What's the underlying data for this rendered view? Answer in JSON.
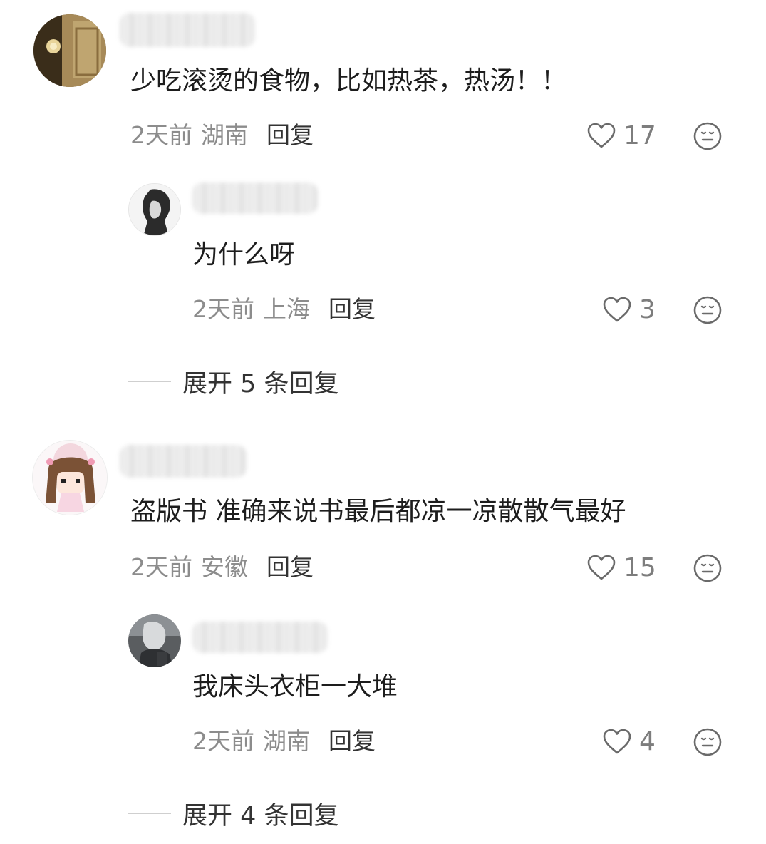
{
  "comments": [
    {
      "text": "少吃滚烫的食物，比如热茶，热汤！！",
      "time": "2天前",
      "location": "湖南",
      "reply_label": "回复",
      "likes": "17",
      "replies": [
        {
          "text": "为什么呀",
          "time": "2天前",
          "location": "上海",
          "reply_label": "回复",
          "likes": "3"
        }
      ],
      "expand_label": "展开 5 条回复"
    },
    {
      "text": "盗版书 准确来说书最后都凉一凉散散气最好",
      "time": "2天前",
      "location": "安徽",
      "reply_label": "回复",
      "likes": "15",
      "replies": [
        {
          "text": "我床头衣柜一大堆",
          "time": "2天前",
          "location": "湖南",
          "reply_label": "回复",
          "likes": "4"
        }
      ],
      "expand_label": "展开 4 条回复"
    }
  ],
  "icons": {
    "like": "heart-outline-icon",
    "reaction": "neutral-face-icon"
  },
  "colors": {
    "text": "#1d1d1d",
    "meta": "#8c8c8c",
    "reply": "#333333",
    "divider": "#cfcfcf"
  }
}
